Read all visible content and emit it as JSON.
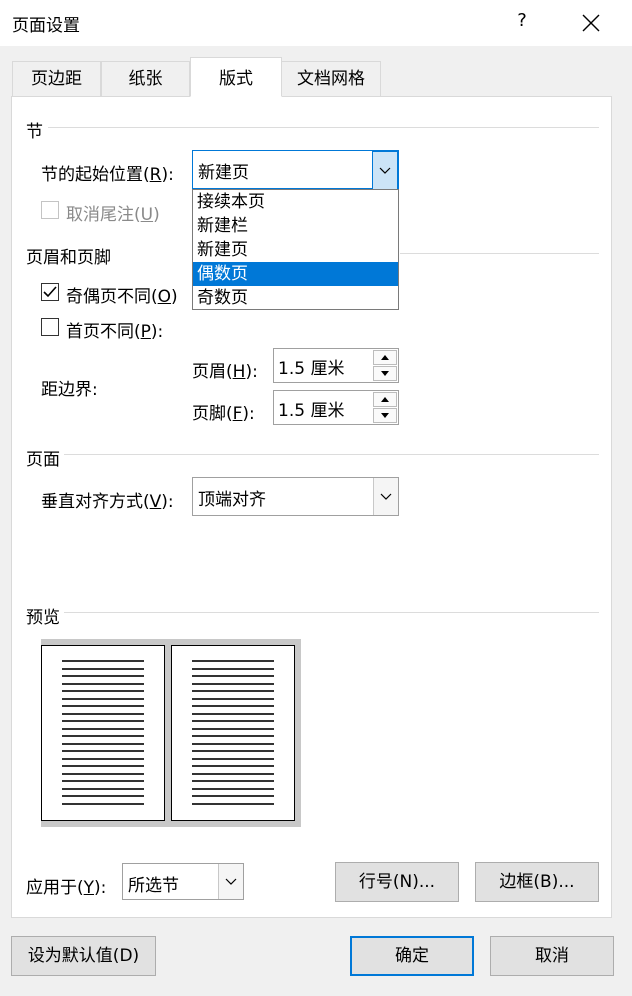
{
  "window": {
    "title": "页面设置",
    "help_label": "?"
  },
  "tabs": [
    {
      "label": "页边距"
    },
    {
      "label": "纸张"
    },
    {
      "label": "版式"
    },
    {
      "label": "文档网格"
    }
  ],
  "section": {
    "heading": "节",
    "start_label": "节的起始位置(",
    "start_key": "R",
    "start_suffix": "):",
    "start_value": "新建页",
    "start_options": [
      "接续本页",
      "新建栏",
      "新建页",
      "偶数页",
      "奇数页"
    ],
    "start_selected_index": 3,
    "suppress_endnotes_label": "取消尾注(",
    "suppress_endnotes_key": "U",
    "suppress_endnotes_suffix": ")",
    "suppress_endnotes_checked": false
  },
  "header_footer": {
    "heading": "页眉和页脚",
    "odd_even_label": "奇偶页不同(",
    "odd_even_key": "O",
    "odd_even_suffix": ")",
    "odd_even_checked": true,
    "first_page_label": "首页不同(",
    "first_page_key": "P",
    "first_page_suffix": "):",
    "first_page_checked": false,
    "from_edge_label": "距边界:",
    "header_label": "页眉(",
    "header_key": "H",
    "header_suffix": "):",
    "header_value": "1.5 厘米",
    "footer_label": "页脚(",
    "footer_key": "F",
    "footer_suffix": "):",
    "footer_value": "1.5 厘米"
  },
  "page": {
    "heading": "页面",
    "valign_label": "垂直对齐方式(",
    "valign_key": "V",
    "valign_suffix": "):",
    "valign_value": "顶端对齐"
  },
  "preview": {
    "heading": "预览"
  },
  "apply": {
    "label": "应用于(",
    "key": "Y",
    "suffix": "):",
    "value": "所选节"
  },
  "buttons": {
    "line_numbers": "行号(N)...",
    "borders": "边框(B)...",
    "set_default": "设为默认值(D)",
    "ok": "确定",
    "cancel": "取消"
  }
}
